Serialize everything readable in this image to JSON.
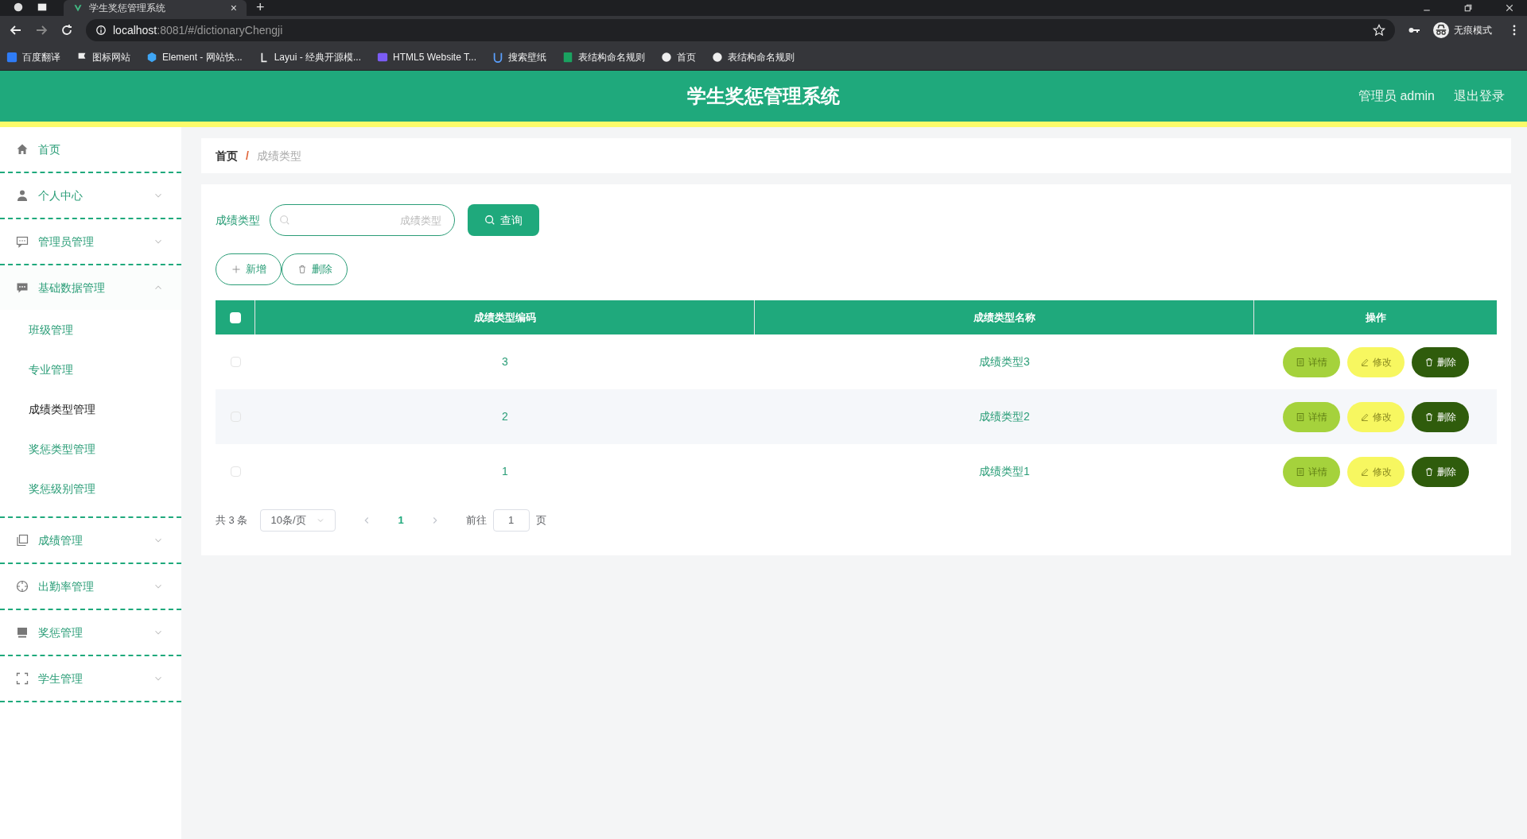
{
  "browser": {
    "tab_title": "学生奖惩管理系统",
    "tab_close": "×",
    "new_tab": "+",
    "url_host": "localhost",
    "url_rest": ":8081/#/dictionaryChengji",
    "incognito": "无痕模式",
    "bookmarks": [
      {
        "label": "百度翻译"
      },
      {
        "label": "图标网站"
      },
      {
        "label": "Element - 网站快..."
      },
      {
        "label": "Layui - 经典开源模..."
      },
      {
        "label": "HTML5 Website T..."
      },
      {
        "label": "搜索壁纸"
      },
      {
        "label": "表结构命名规则"
      },
      {
        "label": "首页"
      },
      {
        "label": "表结构命名规则"
      }
    ]
  },
  "header": {
    "title": "学生奖惩管理系统",
    "user": "管理员 admin",
    "logout": "退出登录"
  },
  "sidebar": {
    "items": [
      {
        "label": "首页"
      },
      {
        "label": "个人中心",
        "expanded": false
      },
      {
        "label": "管理员管理",
        "expanded": false
      },
      {
        "label": "基础数据管理",
        "expanded": true,
        "children": [
          {
            "label": "班级管理",
            "selected": false
          },
          {
            "label": "专业管理",
            "selected": false
          },
          {
            "label": "成绩类型管理",
            "selected": true
          },
          {
            "label": "奖惩类型管理",
            "selected": false
          },
          {
            "label": "奖惩级别管理",
            "selected": false
          }
        ]
      },
      {
        "label": "成绩管理",
        "expanded": false
      },
      {
        "label": "出勤率管理",
        "expanded": false
      },
      {
        "label": "奖惩管理",
        "expanded": false
      },
      {
        "label": "学生管理",
        "expanded": false
      }
    ]
  },
  "breadcrumb": {
    "items": [
      "首页",
      "成绩类型"
    ],
    "separator": "/"
  },
  "search": {
    "label": "成绩类型",
    "placeholder": "成绩类型",
    "button": "查询"
  },
  "actions": [
    "新增",
    "删除"
  ],
  "table": {
    "all_checked": false,
    "columns": [
      "成绩类型编码",
      "成绩类型名称",
      "操作"
    ],
    "rows": [
      {
        "code": "3",
        "name": "成绩类型3",
        "checked": false,
        "buttons": [
          "详情",
          "修改",
          "删除"
        ]
      },
      {
        "code": "2",
        "name": "成绩类型2",
        "checked": false,
        "buttons": [
          "详情",
          "修改",
          "删除"
        ]
      },
      {
        "code": "1",
        "name": "成绩类型1",
        "checked": false,
        "buttons": [
          "详情",
          "修改",
          "删除"
        ]
      }
    ]
  },
  "pagination": {
    "total": "共 3 条",
    "page_size": "10条/页",
    "current": "1",
    "goto_label": "前往",
    "goto_value": "1",
    "goto_suffix": "页"
  }
}
